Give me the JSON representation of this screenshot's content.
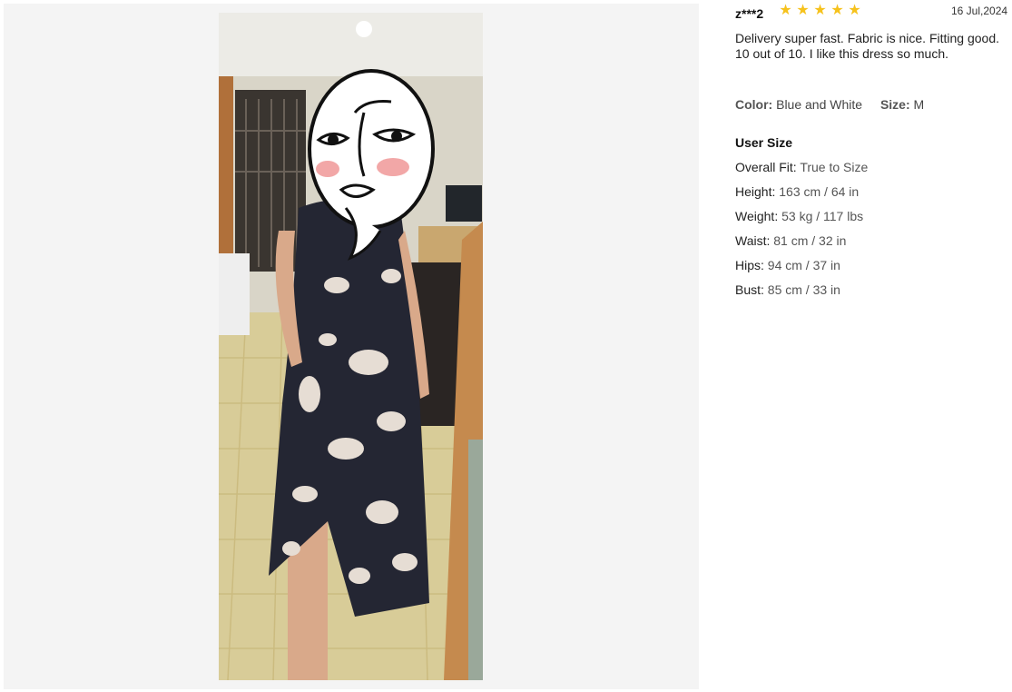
{
  "review": {
    "reviewer": "z***2",
    "rating": 5,
    "date": "16 Jul,2024",
    "text": "Delivery super fast. Fabric is nice. Fitting good. 10 out of 10. I like this dress so much.",
    "color_label": "Color:",
    "color_value": "Blue and White",
    "size_label": "Size:",
    "size_value": "M"
  },
  "user_size": {
    "title": "User Size",
    "rows": [
      {
        "label": "Overall Fit:",
        "value": "True to Size"
      },
      {
        "label": "Height:",
        "value": "163 cm / 64 in"
      },
      {
        "label": "Weight:",
        "value": "53 kg / 117 lbs"
      },
      {
        "label": "Waist:",
        "value": "81 cm / 32 in"
      },
      {
        "label": "Hips:",
        "value": "94 cm / 37 in"
      },
      {
        "label": "Bust:",
        "value": "85 cm / 33 in"
      }
    ]
  },
  "colors": {
    "star": "#f6c21c",
    "gallery_bg": "#f4f4f4"
  },
  "icons": {
    "star": "star-icon"
  }
}
